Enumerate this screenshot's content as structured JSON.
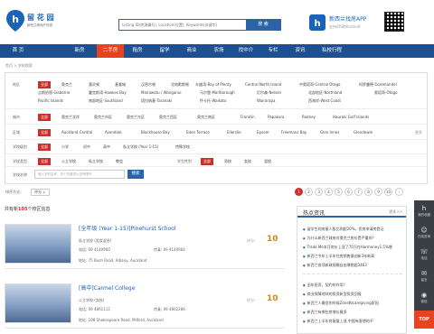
{
  "header": {
    "logo_title": "留 花 园",
    "logo_sub": "新西兰房地产在线",
    "search_placeholder": "Listing ID(房源编号), Location(位置), Keywords(关键字)",
    "search_button": "搜 索",
    "app_title": "新西兰找房APP",
    "app_sub": "支持iOS和Android"
  },
  "nav": [
    "首 页",
    "新房",
    "二手房",
    "租房",
    "留学",
    "商业",
    "农场",
    "找中介",
    "专栏",
    "资讯",
    "私校行程"
  ],
  "nav_active": 2,
  "breadcrumb": "首页 > 学校搜索",
  "filters": {
    "region": {
      "label": "地区",
      "selected": "全部",
      "options": [
        "奥克兰",
        "惠灵顿",
        "基督城",
        "汉密尔顿",
        "北帕默斯顿",
        "丰盛湾-Bay of Plenty",
        "Central North Island",
        "中奥塔哥-Central Otago",
        "科罗曼德-Coromandel"
      ],
      "options2": [
        "吉斯伯恩-Gisborne",
        "霍克斯湾-Hawkes Bay",
        "Manawatu / Wanganui",
        "马尔堡-Marlborough",
        "尼尔森-Nelson",
        "北部地区-Northland",
        "奥塔哥-Otago"
      ],
      "options3": [
        "Pacific Islands",
        "南部地区-Southland",
        "塔拉纳基-Taranaki",
        "怀卡托-Waikato",
        "Wairarapa",
        "西海岸-West Coast"
      ]
    },
    "city": {
      "label": "城市",
      "selected": "全部",
      "options": [
        "奥克兰北岸",
        "奥克兰市区",
        "奥克兰东区",
        "奥克兰西区",
        "奥克兰南区",
        "Franklin",
        "Papakura",
        "Rodney",
        "Hauraki Gulf Islands"
      ]
    },
    "district": {
      "label": "区域",
      "selected": "全部",
      "options": [
        "Auckland Central",
        "Avondale",
        "Blockhouse Bay",
        "Eden Terrace",
        "Ellerslie",
        "Epsom",
        "Freemans Bay",
        "Glen Innes",
        "Glendowie"
      ],
      "more": "更多"
    },
    "level": {
      "label": "学校级别",
      "selected": "全部",
      "options": [
        "小学",
        "初中",
        "高中",
        "私立学校 (Year 1-15)",
        "特殊学校"
      ]
    },
    "type": {
      "label": "学校类型",
      "selected": "全部",
      "options": [
        "公立学校",
        "私立学校",
        "教会"
      ],
      "gender_label": "学生性别",
      "gender_selected": "全部",
      "gender_options": [
        "男校",
        "女校",
        "混校"
      ]
    },
    "keyword": {
      "label": "学校名称",
      "placeholder": "输入学校名称、多个关键词以逗号隔开",
      "button": "搜索"
    }
  },
  "sort": {
    "label": "排序方式：",
    "option": "评分 ↓"
  },
  "pager": {
    "pages": [
      "1",
      "2",
      "3",
      "4",
      "5",
      "6",
      "7",
      "8",
      "9",
      "10",
      "›"
    ],
    "current": "1"
  },
  "results": {
    "prefix": "共有新",
    "count": "105",
    "suffix": "个校区信息",
    "items": [
      {
        "title": "[全年级 (Year 1-15)]Pinehurst School",
        "kind": "私立学校 (男女混合)",
        "phone": "电话: 09 4140960",
        "fax": "传真: 09 4140964",
        "address": "地址: 75 Bush Road, Albany, Auckland",
        "score_label": "评分:",
        "score": "10"
      },
      {
        "title": "[高中]Carmel College",
        "kind": "公立学校 (女校)",
        "phone": "电话: 09 4861112",
        "fax": "传真: 09 4862286",
        "address": "地址: 108 Shakespeare Road, Milford, Auckland",
        "score_label": "评分:",
        "score": "10"
      }
    ]
  },
  "sidebar": {
    "title": "热点资讯",
    "more": "更多>>",
    "news": [
      "留学生的房屋人股比例超20%，侨房申请房登记",
      "为什么新西兰政府对奥克兰房价是严重的？",
      "Trade Me本月房价上涨了70万在Harmoney1.5%增",
      "新西兰今年上半年住房销售量创新3年新高",
      "新西兰各项新政规模自由增税超3463",
      "",
      "旧年投资，契约的作用？",
      "商业保障地块的投资新型投资回报",
      "新西兰人最信的时候Zone和caregiving家园",
      "新西兰有哪些房增长最多",
      "新西兰上半年房屋量上涨 中国有意想的不"
    ]
  },
  "float_bar": {
    "items": [
      {
        "icon": "h",
        "label": "我的收藏"
      },
      {
        "icon": "☺",
        "label": "在线咨询"
      },
      {
        "icon": "☏",
        "label": "电话"
      },
      {
        "icon": "✉",
        "label": "留言"
      },
      {
        "icon": "◉",
        "label": "微信"
      }
    ],
    "top": "TOP"
  },
  "colors": {
    "brand": "#1e4f91",
    "accent": "#e8431f",
    "selected": "#c9302c",
    "score": "#d58512"
  }
}
